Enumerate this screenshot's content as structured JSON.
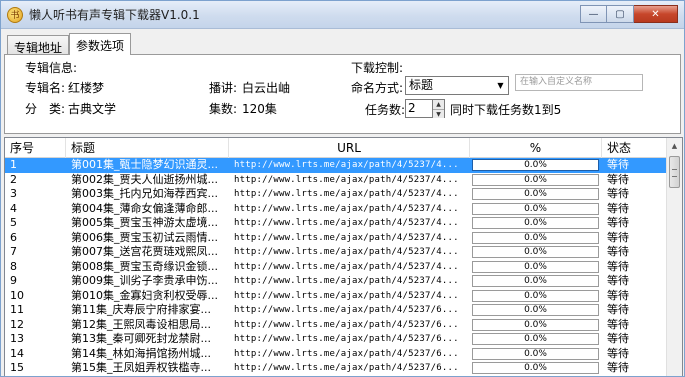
{
  "window": {
    "title": "懒人听书有声专辑下载器V1.0.1",
    "app_icon_glyph": "书",
    "minimize_glyph": "—",
    "maximize_glyph": "▢",
    "close_glyph": "✕"
  },
  "tabs": [
    {
      "label": "专辑地址",
      "active": false
    },
    {
      "label": "参数选项",
      "active": true
    }
  ],
  "album_info": {
    "group_title": "专辑信息:",
    "name_label": "专辑名:",
    "name_value": "红楼梦",
    "anchor_label": "播讲:",
    "anchor_value": "白云出岫",
    "category_label": "分　类:",
    "category_value": "古典文学",
    "episodes_label": "集数:",
    "episodes_value": "120集"
  },
  "download_control": {
    "group_title": "下载控制:",
    "naming_label": "命名方式:",
    "naming_value": "标题",
    "custom_name_placeholder": "在输入自定义名称",
    "task_label": "任务数:",
    "task_value": "2",
    "task_hint": "同时下载任务数1到5"
  },
  "list": {
    "columns": [
      "序号",
      "标题",
      "URL",
      "%",
      "状态"
    ],
    "rows": [
      {
        "no": "1",
        "title": "第001集_甄士隐梦幻识通灵...",
        "url": "http://www.lrts.me/ajax/path/4/5237/4...",
        "pct": "0.0%",
        "status": "等待",
        "selected": true
      },
      {
        "no": "2",
        "title": "第002集_贾夫人仙逝扬州城...",
        "url": "http://www.lrts.me/ajax/path/4/5237/4...",
        "pct": "0.0%",
        "status": "等待"
      },
      {
        "no": "3",
        "title": "第003集_托内兄如海荐西宾...",
        "url": "http://www.lrts.me/ajax/path/4/5237/4...",
        "pct": "0.0%",
        "status": "等待"
      },
      {
        "no": "4",
        "title": "第004集_薄命女偏逢薄命郎...",
        "url": "http://www.lrts.me/ajax/path/4/5237/4...",
        "pct": "0.0%",
        "status": "等待"
      },
      {
        "no": "5",
        "title": "第005集_贾宝玉神游太虚境...",
        "url": "http://www.lrts.me/ajax/path/4/5237/4...",
        "pct": "0.0%",
        "status": "等待"
      },
      {
        "no": "6",
        "title": "第006集_贾宝玉初试云雨情...",
        "url": "http://www.lrts.me/ajax/path/4/5237/4...",
        "pct": "0.0%",
        "status": "等待"
      },
      {
        "no": "7",
        "title": "第007集_送宫花贾琏戏熙凤...",
        "url": "http://www.lrts.me/ajax/path/4/5237/4...",
        "pct": "0.0%",
        "status": "等待"
      },
      {
        "no": "8",
        "title": "第008集_贾宝玉奇缘识金锁...",
        "url": "http://www.lrts.me/ajax/path/4/5237/4...",
        "pct": "0.0%",
        "status": "等待"
      },
      {
        "no": "9",
        "title": "第009集_训劣子李贵承申饬...",
        "url": "http://www.lrts.me/ajax/path/4/5237/4...",
        "pct": "0.0%",
        "status": "等待"
      },
      {
        "no": "10",
        "title": "第010集_金寡妇贪利权受辱...",
        "url": "http://www.lrts.me/ajax/path/4/5237/4...",
        "pct": "0.0%",
        "status": "等待"
      },
      {
        "no": "11",
        "title": "第11集_庆寿辰宁府排家宴...",
        "url": "http://www.lrts.me/ajax/path/4/5237/6...",
        "pct": "0.0%",
        "status": "等待"
      },
      {
        "no": "12",
        "title": "第12集_王熙凤毒设相思局...",
        "url": "http://www.lrts.me/ajax/path/4/5237/6...",
        "pct": "0.0%",
        "status": "等待"
      },
      {
        "no": "13",
        "title": "第13集_秦可卿死封龙禁尉...",
        "url": "http://www.lrts.me/ajax/path/4/5237/6...",
        "pct": "0.0%",
        "status": "等待"
      },
      {
        "no": "14",
        "title": "第14集_林如海捐馆扬州城...",
        "url": "http://www.lrts.me/ajax/path/4/5237/6...",
        "pct": "0.0%",
        "status": "等待"
      },
      {
        "no": "15",
        "title": "第15集_王凤姐弄权铁槛寺...",
        "url": "http://www.lrts.me/ajax/path/4/5237/6...",
        "pct": "0.0%",
        "status": "等待"
      }
    ]
  },
  "scrollbar": {
    "up_glyph": "▲"
  },
  "colors": {
    "selection": "#3399ff",
    "title_bar": "#cfdcee",
    "close_button": "#c7462b"
  }
}
